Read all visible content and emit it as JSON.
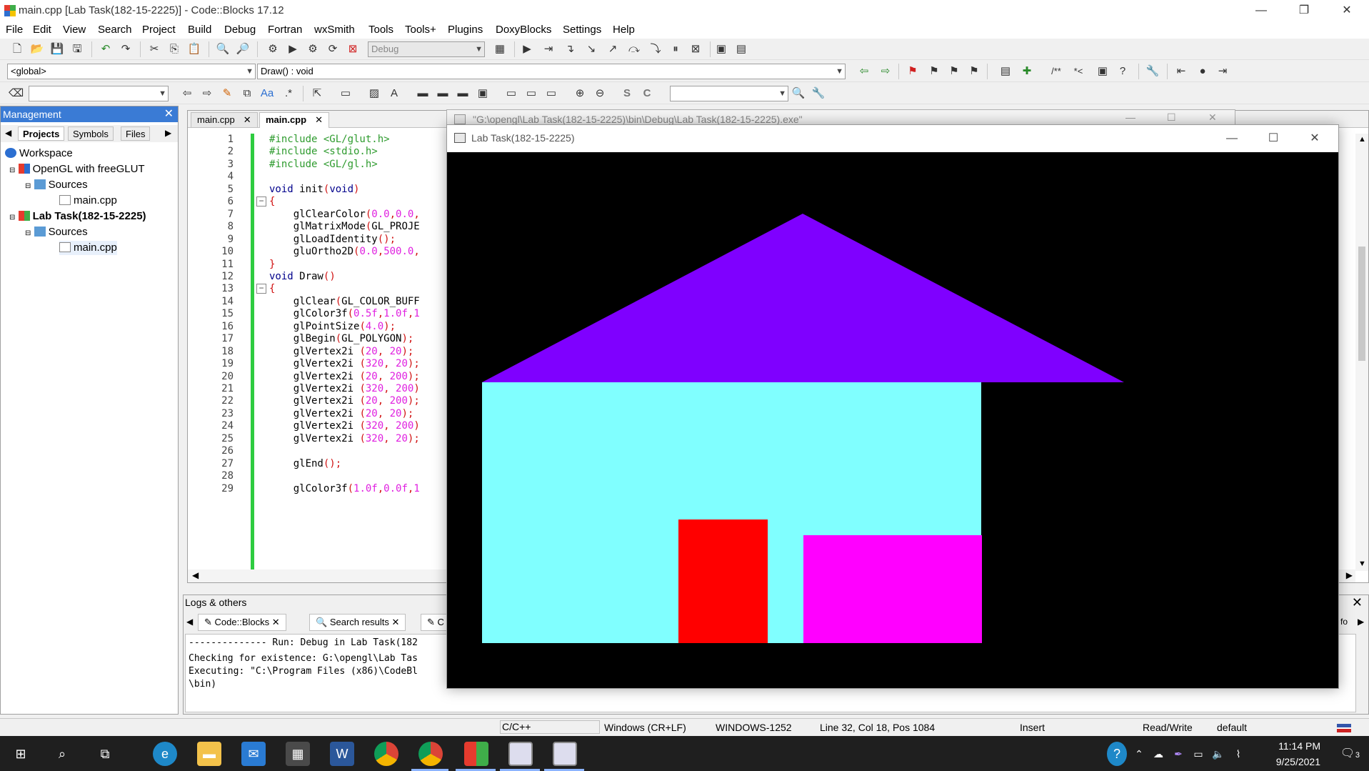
{
  "title_bar": {
    "title": "main.cpp [Lab Task(182-15-2225)] - Code::Blocks 17.12",
    "min": "—",
    "max": "❐",
    "close": "✕"
  },
  "menu": [
    "File",
    "Edit",
    "View",
    "Search",
    "Project",
    "Build",
    "Debug",
    "Fortran",
    "wxSmith",
    "Tools",
    "Tools+",
    "Plugins",
    "DoxyBlocks",
    "Settings",
    "Help"
  ],
  "toolbar": {
    "build_target": "Debug",
    "scope": "<global>",
    "function": "Draw() : void",
    "doxy_comment": "/**",
    "doxy_line": "*<"
  },
  "management": {
    "header": "Management",
    "tabs": [
      "Projects",
      "Symbols",
      "Files"
    ],
    "tree": [
      {
        "label": "Workspace",
        "icon": "workspace-icon"
      },
      {
        "label": "OpenGL with freeGLUT",
        "icon": "project-icon"
      },
      {
        "label": "Sources",
        "icon": "folder-icon"
      },
      {
        "label": "main.cpp",
        "icon": "file-icon"
      },
      {
        "label": "Lab Task(182-15-2225)",
        "icon": "project-icon"
      },
      {
        "label": "Sources",
        "icon": "folder-icon"
      },
      {
        "label": "main.cpp",
        "icon": "file-icon"
      }
    ]
  },
  "editor": {
    "tabs": [
      "main.cpp",
      "main.cpp"
    ],
    "line_numbers": [
      "1",
      "2",
      "3",
      "4",
      "5",
      "6",
      "7",
      "8",
      "9",
      "10",
      "11",
      "12",
      "13",
      "14",
      "15",
      "16",
      "17",
      "18",
      "19",
      "20",
      "21",
      "22",
      "23",
      "24",
      "25",
      "26",
      "27",
      "28",
      "29"
    ],
    "lines": [
      "#include <GL/glut.h>",
      "#include <stdio.h>",
      "#include <GL/gl.h>",
      "",
      "void init(void)",
      "{",
      "    glClearColor(0.0,0.0,",
      "    glMatrixMode(GL_PROJE",
      "    glLoadIdentity();",
      "    gluOrtho2D(0.0,500.0,",
      "}",
      "void Draw()",
      "{",
      "    glClear(GL_COLOR_BUFF",
      "    glColor3f(0.5f,1.0f,1",
      "    glPointSize(4.0);",
      "    glBegin(GL_POLYGON);",
      "    glVertex2i (20, 20);",
      "    glVertex2i (320, 20);",
      "    glVertex2i (20, 200);",
      "    glVertex2i (320, 200)",
      "    glVertex2i (20, 200);",
      "    glVertex2i (20, 20);",
      "    glVertex2i (320, 200)",
      "    glVertex2i (320, 20);",
      "",
      "    glEnd();",
      "",
      "    glColor3f(1.0f,0.0f,1"
    ]
  },
  "logs": {
    "title": "Logs & others",
    "tabs": [
      "Code::Blocks",
      "Search results",
      "C"
    ],
    "lines": [
      "-------------- Run: Debug in Lab Task(182",
      "Checking for existence: G:\\opengl\\Lab Tas",
      "Executing: \"C:\\Program Files (x86)\\CodeBl",
      "\\bin)"
    ],
    "side_label": "fo"
  },
  "console_window": {
    "title": "\"G:\\opengl\\Lab Task(182-15-2225)\\bin\\Debug\\Lab Task(182-15-2225).exe\""
  },
  "gl_window": {
    "title": "Lab Task(182-15-2225)",
    "scene": {
      "background": "#000000",
      "walls": "#80ffff",
      "roof": "#7f00ff",
      "door": "#ff0000",
      "window": "#ff00ff"
    }
  },
  "status_bar": {
    "language": "C/C++",
    "line_endings": "Windows (CR+LF)",
    "encoding": "WINDOWS-1252",
    "position": "Line 32, Col 18, Pos 1084",
    "mode": "Insert",
    "access": "Read/Write",
    "profile": "default"
  },
  "taskbar": {
    "time": "11:14 PM",
    "date": "9/25/2021",
    "notifications": "3",
    "apps": [
      "start-icon",
      "search-icon",
      "task-view-icon",
      "edge-icon",
      "file-explorer-icon",
      "mail-icon",
      "calculator-icon",
      "word-icon",
      "chrome-icon",
      "chrome-profile-icon",
      "codeblocks-icon",
      "app-window-icon",
      "app-window-icon"
    ]
  }
}
